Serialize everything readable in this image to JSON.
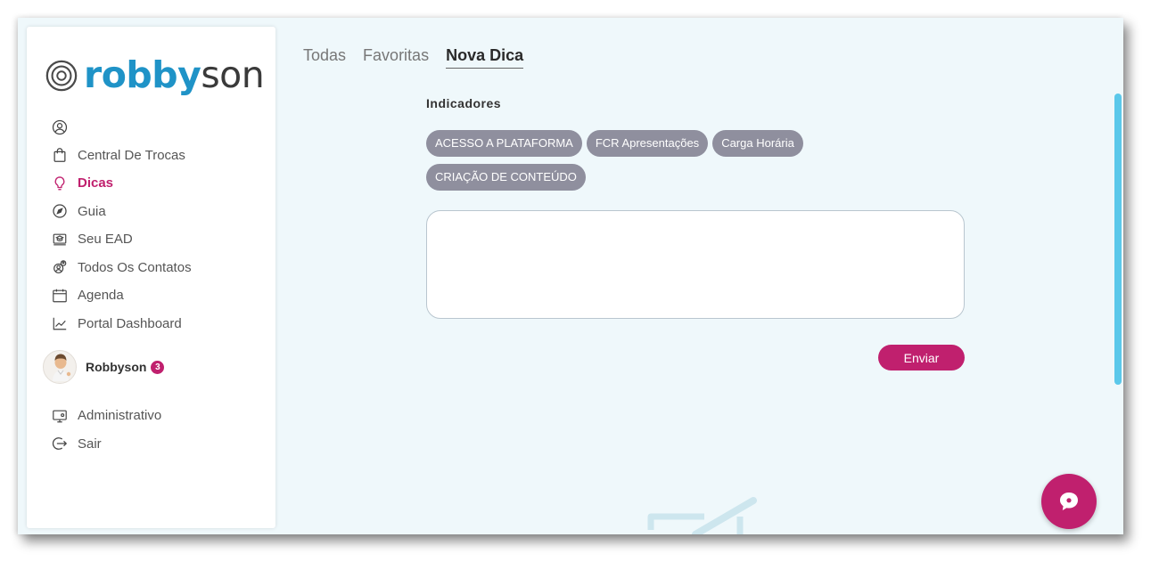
{
  "brand": {
    "logo_part1": "robby",
    "logo_part2": "son"
  },
  "sidebar": {
    "items": [
      {
        "label": "",
        "icon": "user-circle-icon"
      },
      {
        "label": "Central De Trocas",
        "icon": "shopping-bag-icon"
      },
      {
        "label": "Dicas",
        "icon": "lightbulb-icon",
        "active": true
      },
      {
        "label": "Guia",
        "icon": "compass-icon"
      },
      {
        "label": "Seu EAD",
        "icon": "presentation-icon"
      },
      {
        "label": "Todos Os Contatos",
        "icon": "contacts-icon"
      },
      {
        "label": "Agenda",
        "icon": "calendar-icon"
      },
      {
        "label": "Portal Dashboard",
        "icon": "chart-line-icon"
      }
    ],
    "user": {
      "name": "Robbyson",
      "badge": "3"
    },
    "bottom_items": [
      {
        "label": "Administrativo",
        "icon": "admin-screen-icon"
      },
      {
        "label": "Sair",
        "icon": "logout-icon"
      }
    ]
  },
  "tabs": [
    {
      "label": "Todas"
    },
    {
      "label": "Favoritas"
    },
    {
      "label": "Nova Dica",
      "active": true
    }
  ],
  "form": {
    "section_title": "Indicadores",
    "chips": [
      "ACESSO A PLATAFORMA",
      "FCR Apresentações",
      "Carga Horária",
      "CRIAÇÃO DE CONTEÚDO"
    ],
    "textarea_value": "",
    "textarea_placeholder": "",
    "send_label": "Enviar"
  },
  "colors": {
    "accent": "#c0206e",
    "brand_blue": "#1f93c7",
    "chip_bg": "#8f8f9e",
    "background": "#eff8fb",
    "scrollbar": "#5bc8ea"
  }
}
